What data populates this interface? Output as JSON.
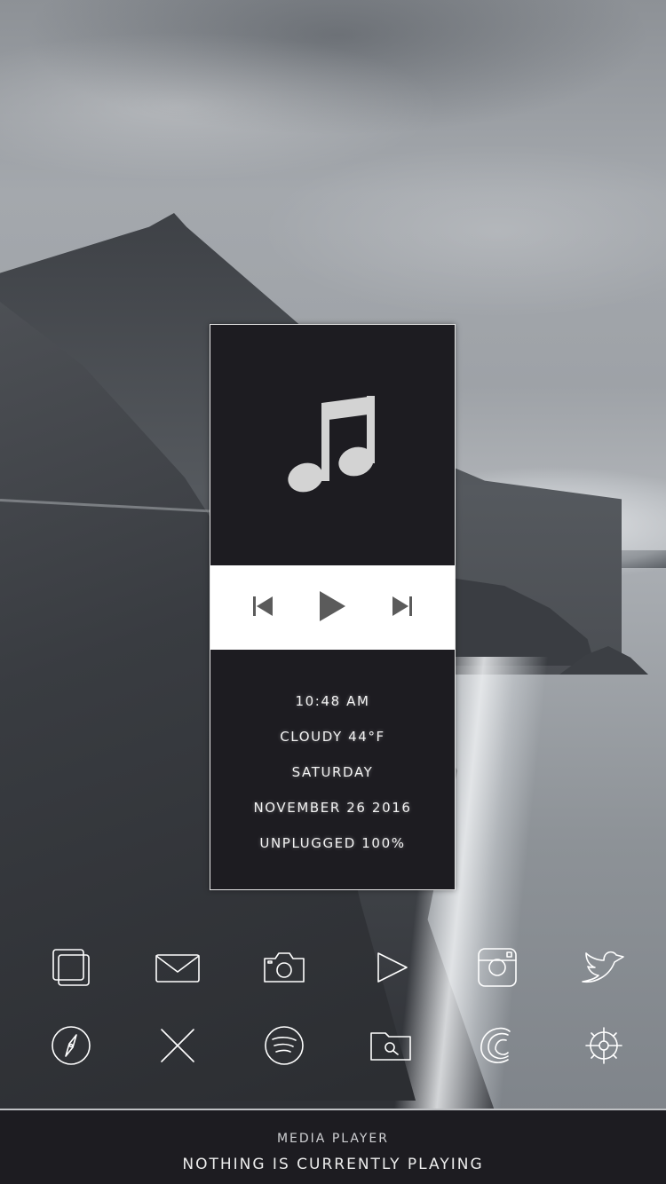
{
  "widget": {
    "info": {
      "time": "10:48 AM",
      "weather": "CLOUDY 44°F",
      "day": "SATURDAY",
      "date": "NOVEMBER 26 2016",
      "battery": "UNPLUGGED 100%"
    },
    "art_icon": "music-note-icon",
    "controls": [
      "previous-track-icon",
      "play-icon",
      "next-track-icon"
    ]
  },
  "dock": {
    "row1": [
      "pages-icon",
      "mail-icon",
      "camera-icon",
      "videos-icon",
      "instagram-icon",
      "twitter-icon"
    ],
    "row2": [
      "safari-icon",
      "x-icon",
      "spotify-icon",
      "file-browser-icon",
      "browser-icon",
      "settings-gear-icon"
    ]
  },
  "bottom_bar": {
    "title": "MEDIA PLAYER",
    "status": "NOTHING IS CURRENTLY PLAYING"
  },
  "colors": {
    "panel": "#1d1c21",
    "controls_bg": "#ffffff",
    "icon_stroke": "#ffffff",
    "glyph_gray": "#d3d3d3"
  }
}
